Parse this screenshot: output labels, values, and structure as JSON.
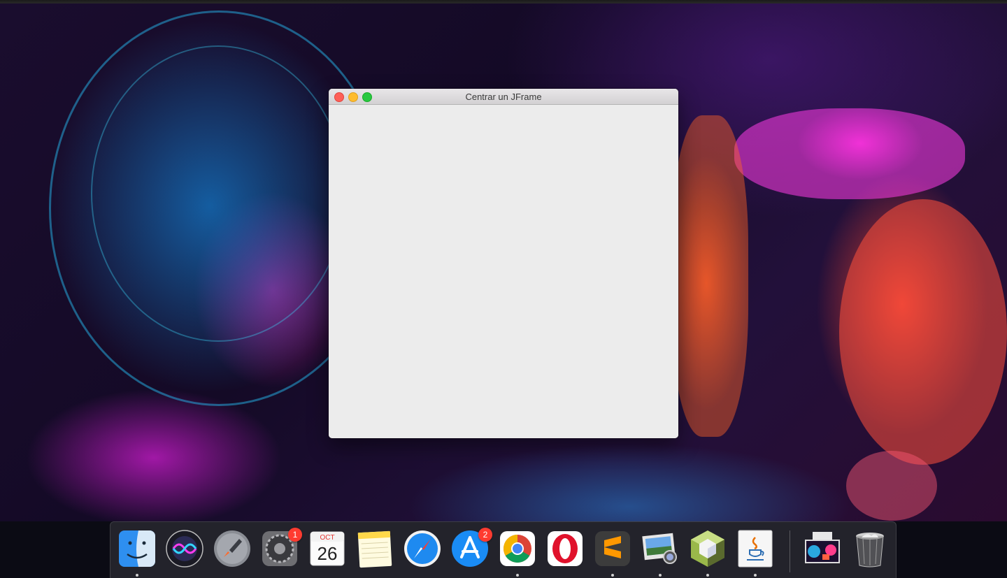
{
  "window": {
    "title": "Centrar un JFrame"
  },
  "dock": {
    "items": [
      {
        "name": "Finder",
        "icon": "finder-icon",
        "running": true
      },
      {
        "name": "Siri",
        "icon": "siri-icon",
        "running": false
      },
      {
        "name": "Launchpad",
        "icon": "launchpad-icon",
        "running": false
      },
      {
        "name": "System Preferences",
        "icon": "system-preferences-icon",
        "running": false,
        "badge": "1"
      },
      {
        "name": "Calendar",
        "icon": "calendar-icon",
        "running": false,
        "month": "OCT",
        "day": "26"
      },
      {
        "name": "Notes",
        "icon": "notes-icon",
        "running": false
      },
      {
        "name": "Safari",
        "icon": "safari-icon",
        "running": false
      },
      {
        "name": "App Store",
        "icon": "app-store-icon",
        "running": false,
        "badge": "2"
      },
      {
        "name": "Google Chrome",
        "icon": "chrome-icon",
        "running": true
      },
      {
        "name": "Opera",
        "icon": "opera-icon",
        "running": false
      },
      {
        "name": "Sublime Text",
        "icon": "sublime-text-icon",
        "running": true
      },
      {
        "name": "Preview",
        "icon": "preview-icon",
        "running": true
      },
      {
        "name": "NetBeans",
        "icon": "netbeans-icon",
        "running": true
      },
      {
        "name": "Java",
        "icon": "java-icon",
        "running": true
      },
      {
        "name": "Screenshot",
        "icon": "screenshot-thumbnail-icon",
        "running": false
      },
      {
        "name": "Trash",
        "icon": "trash-icon",
        "running": false
      }
    ]
  },
  "colors": {
    "close": "#fe5f57",
    "minimize": "#febc2e",
    "maximize": "#28c840",
    "window_bg": "#ececec",
    "badge": "#ff3b30"
  }
}
